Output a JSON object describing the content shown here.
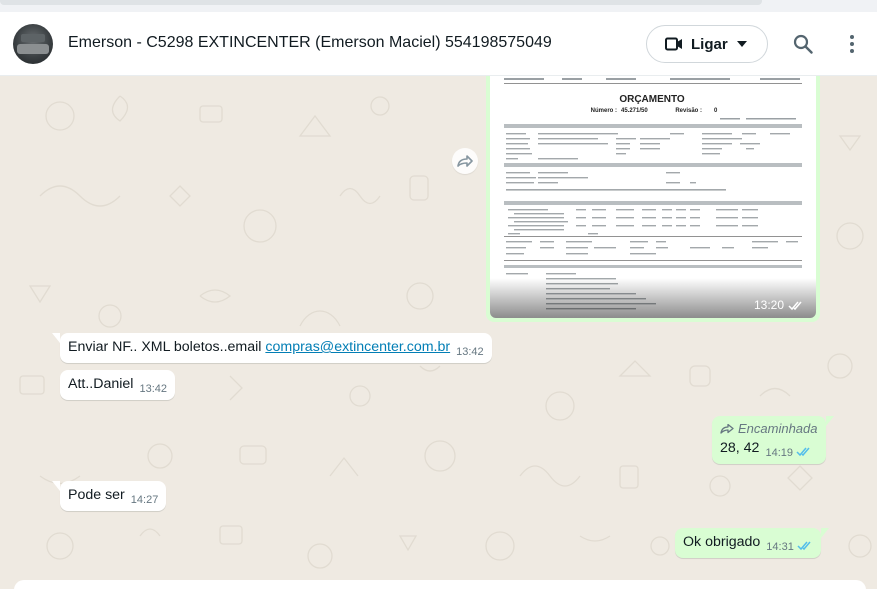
{
  "header": {
    "title": "Emerson - C5298 EXTINCENTER (Emerson Maciel) 554198575049",
    "call_label": "Ligar"
  },
  "messages": {
    "image": {
      "time": "13:20"
    },
    "m1": {
      "text": "Enviar NF.. XML boletos..email ",
      "link": "compras@extincenter.com.br",
      "time": "13:42"
    },
    "m2": {
      "text": "Att..Daniel",
      "time": "13:42"
    },
    "m3": {
      "forwarded_label": "Encaminhada",
      "text": "28, 42",
      "time": "14:19"
    },
    "m4": {
      "text": "Pode ser",
      "time": "14:27"
    },
    "m5": {
      "text": "Ok obrigado",
      "time": "14:31"
    }
  },
  "document": {
    "title": "ORÇAMENTO",
    "numero_label": "Número :",
    "numero": "45.271/50",
    "revisao_label": "Revisão :",
    "revisao": "0"
  },
  "colors": {
    "outgoing_bubble": "#d9fdd3",
    "incoming_bubble": "#ffffff",
    "chat_background": "#efeae2",
    "read_ticks": "#53bdeb",
    "link": "#027eb5"
  }
}
